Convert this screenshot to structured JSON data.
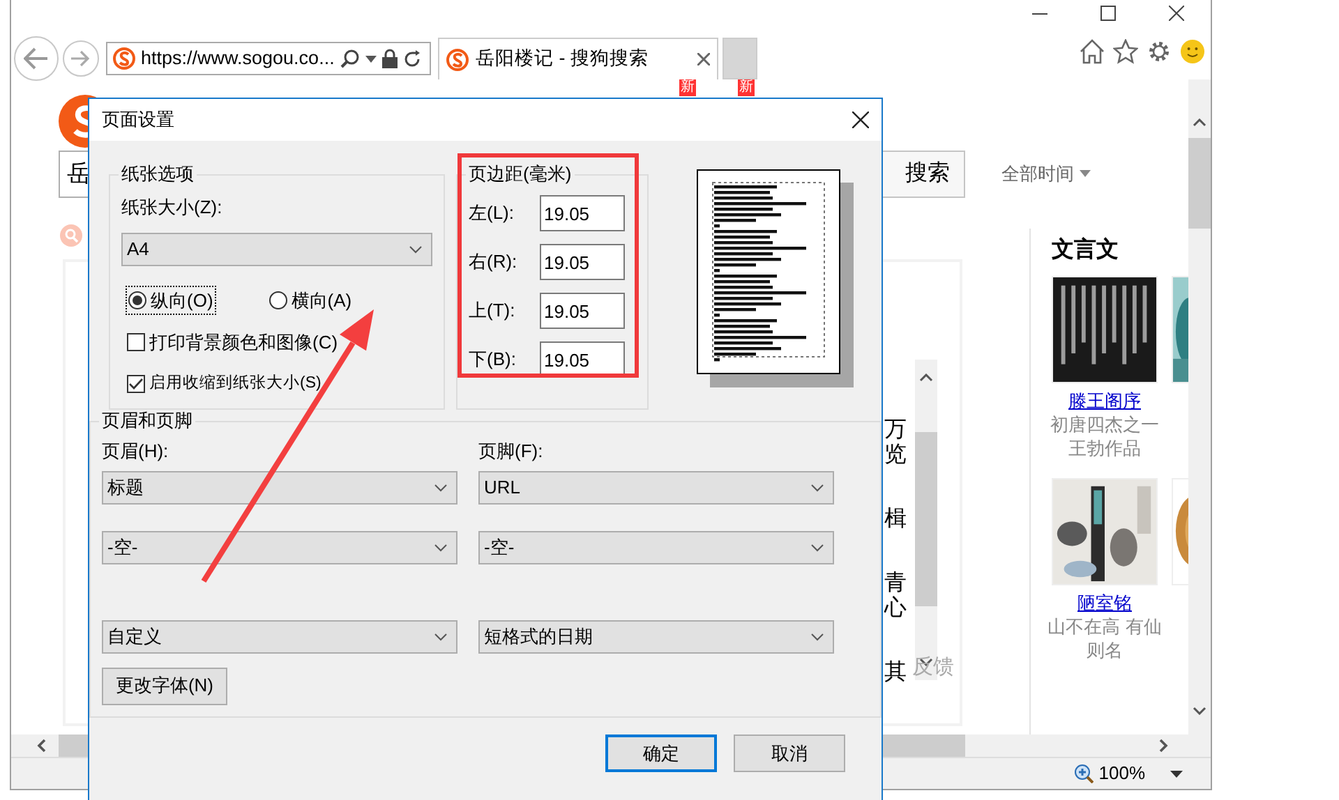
{
  "browser": {
    "address": "https://www.sogou.co...",
    "tabs": [
      {
        "title": "岳阳楼记 - 搜狗搜索",
        "selected": true
      }
    ],
    "badges": [
      "新",
      "新"
    ]
  },
  "page": {
    "search_query": "岳",
    "search_button": "搜索",
    "time_filter": "全部时间",
    "result_fragments": [
      [
        "万",
        "览"
      ],
      [
        "楫"
      ],
      [
        "青",
        "心"
      ],
      [
        "其"
      ]
    ],
    "feedback": "反馈",
    "side_title": "文言文",
    "cards": [
      {
        "kind": "picture",
        "title": "滕王阁序",
        "lines": [
          "初唐四杰之一",
          "王勃作品"
        ]
      },
      {
        "kind": "picture"
      },
      {
        "kind": "picture",
        "title": "陋室铭",
        "lines": [
          "山不在高 有仙",
          "则名"
        ]
      },
      {
        "kind": "picture"
      }
    ]
  },
  "status_bar": {
    "zoom": "100%"
  },
  "dialog": {
    "title": "页面设置",
    "paper": {
      "legend": "纸张选项",
      "size_label": "纸张大小(Z):",
      "size": "A4",
      "orientations": [
        {
          "label": "纵向(O)",
          "selected": true,
          "focused": true
        },
        {
          "label": "横向(A)",
          "selected": false,
          "focused": false
        }
      ],
      "options": [
        {
          "label": "打印背景颜色和图像(C)",
          "checked": false
        },
        {
          "label": "启用收缩到纸张大小(S)",
          "checked": true
        }
      ]
    },
    "margins": {
      "legend": "页边距(毫米)",
      "fields": [
        {
          "label": "左(L):",
          "value": "19.05"
        },
        {
          "label": "右(R):",
          "value": "19.05"
        },
        {
          "label": "上(T):",
          "value": "19.05"
        },
        {
          "label": "下(B):",
          "value": "19.05"
        }
      ]
    },
    "header_footer": {
      "legend": "页眉和页脚",
      "header_label": "页眉(H):",
      "footer_label": "页脚(F):",
      "header": [
        "标题",
        "-空-",
        "自定义"
      ],
      "footer": [
        "URL",
        "-空-",
        "短格式的日期"
      ],
      "font_button": "更改字体(N)"
    },
    "buttons": [
      {
        "label": "确定",
        "default": true
      },
      {
        "label": "取消",
        "default": false
      }
    ]
  },
  "annotations": {
    "highlight_box": true,
    "arrow": true
  }
}
